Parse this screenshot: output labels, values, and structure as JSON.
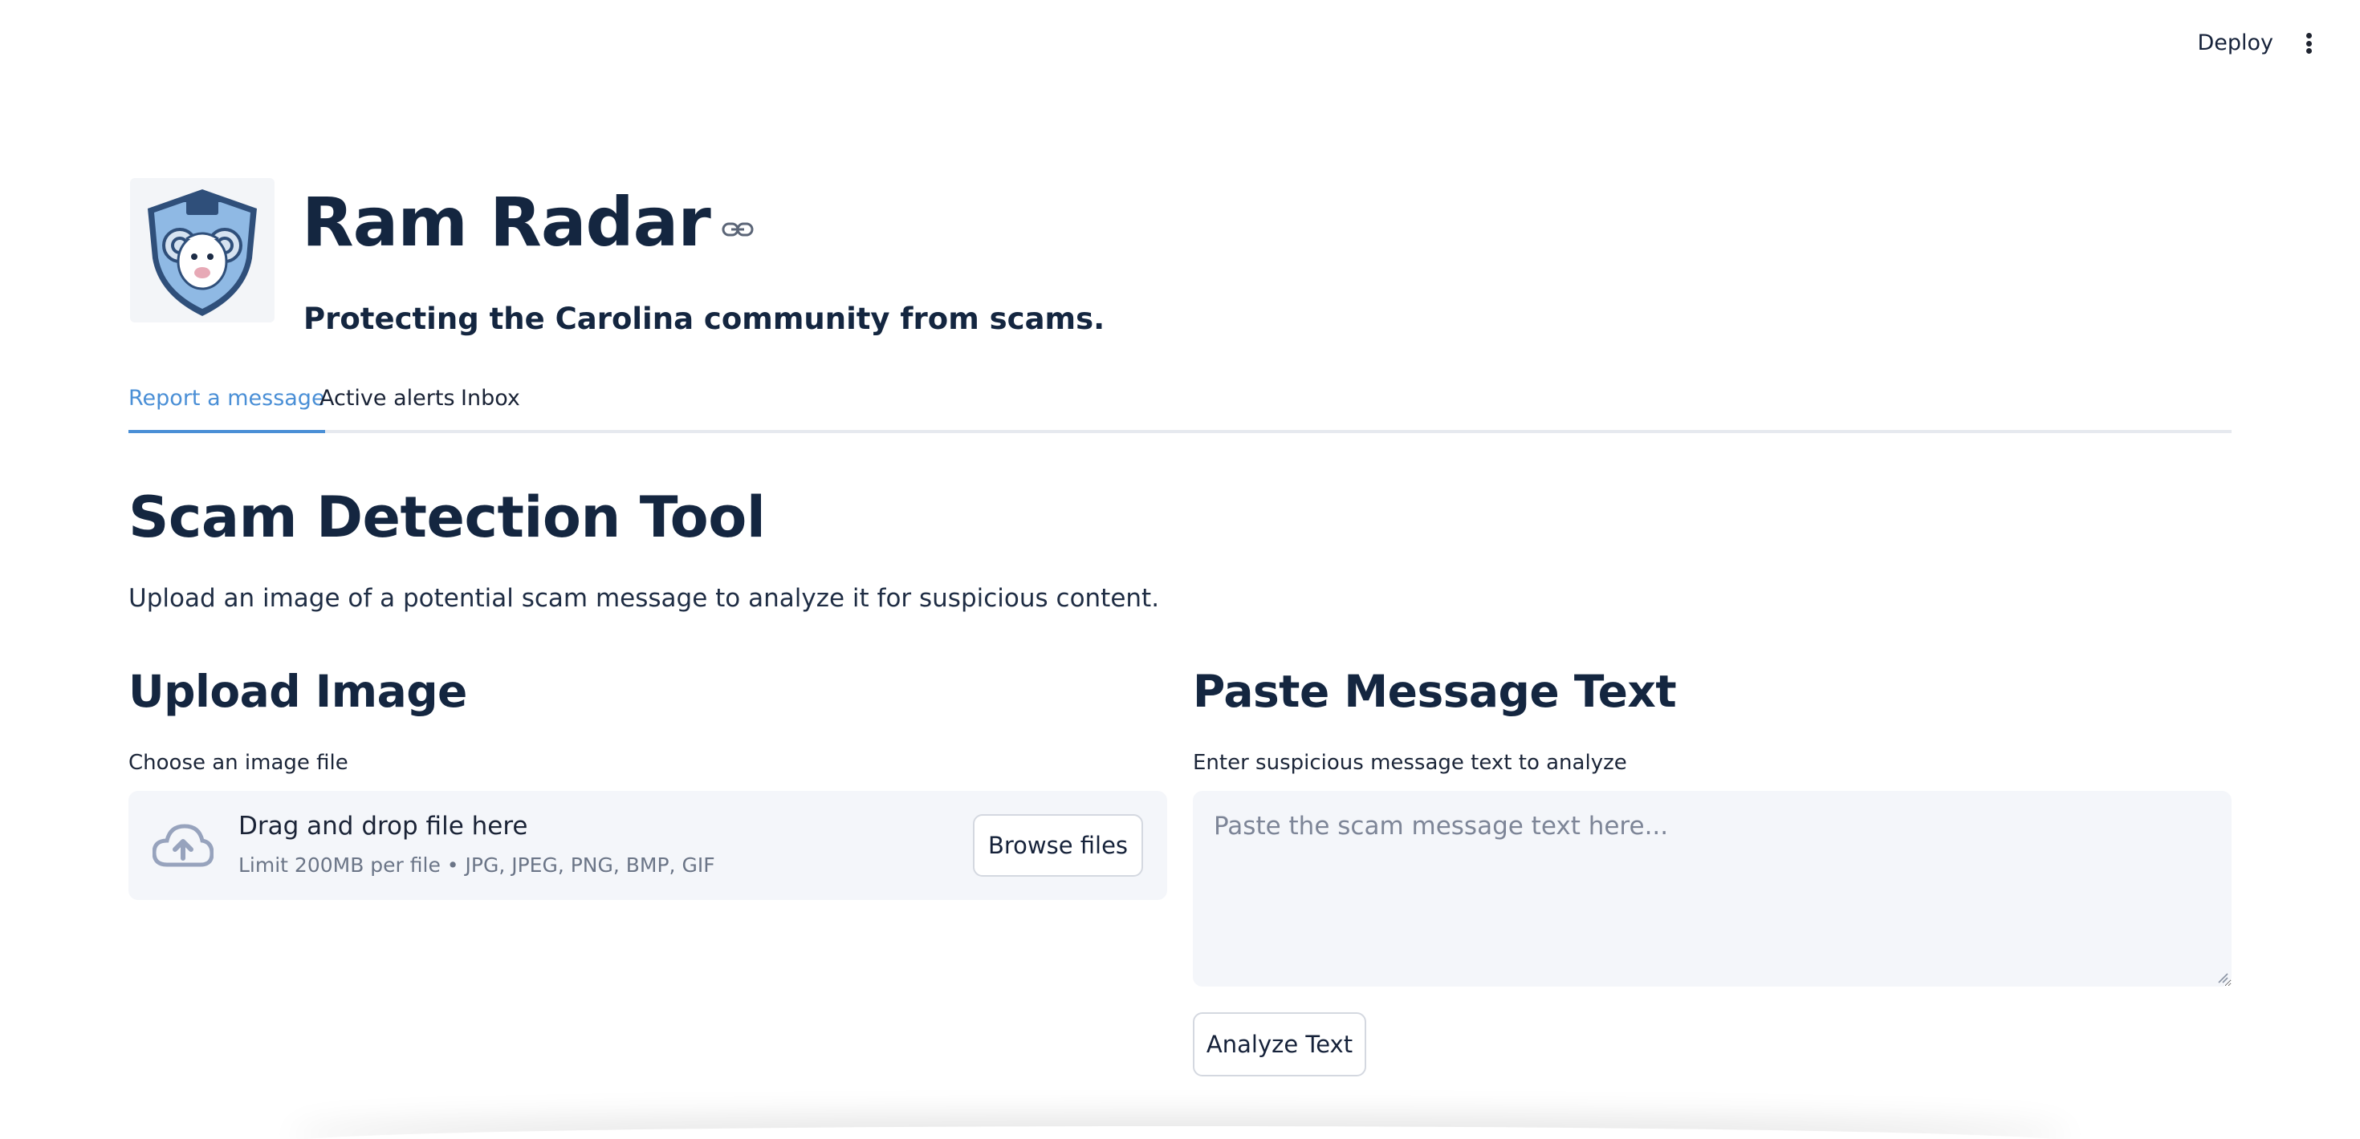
{
  "header": {
    "deploy_label": "Deploy",
    "menu_icon": "kebab-menu-icon"
  },
  "brand": {
    "logo_icon": "ram-shield-logo",
    "title": "Ram Radar",
    "tagline": "Protecting the Carolina community from scams.",
    "link_icon": "link-icon"
  },
  "tabs": [
    {
      "label": "Report a message",
      "active": true
    },
    {
      "label": "Active alerts",
      "active": false
    },
    {
      "label": "Inbox",
      "active": false
    }
  ],
  "main": {
    "title": "Scam Detection Tool",
    "intro": "Upload an image of a potential scam message to analyze it for suspicious content."
  },
  "upload": {
    "heading": "Upload Image",
    "label": "Choose an image file",
    "drop_text": "Drag and drop file here",
    "limit_text": "Limit 200MB per file • JPG, JPEG, PNG, BMP, GIF",
    "browse_label": "Browse files",
    "icon": "cloud-upload-icon"
  },
  "paste": {
    "heading": "Paste Message Text",
    "label": "Enter suspicious message text to analyze",
    "placeholder": "Paste the scam message text here...",
    "value": "",
    "analyze_label": "Analyze Text"
  },
  "colors": {
    "primary_text": "#142640",
    "accent": "#4a8fd6",
    "input_bg": "#f4f6fa"
  }
}
